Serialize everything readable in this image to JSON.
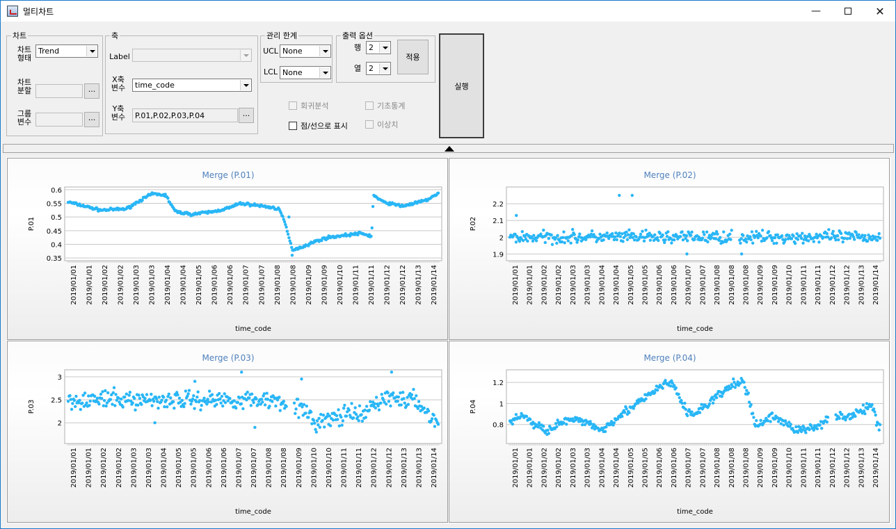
{
  "window": {
    "title": "멀티차트"
  },
  "chart_group": {
    "title": "차트",
    "type_label": "차트\n형태",
    "type_value": "Trend",
    "split_label": "차트\n분할",
    "split_value": "",
    "split_button": "...",
    "group_label": "그룹\n변수",
    "group_value": "",
    "group_button": "..."
  },
  "axis_group": {
    "title": "축",
    "label_label": "Label",
    "label_value": "",
    "x_label": "X축\n변수",
    "x_value": "time_code",
    "y_label": "Y축\n변수",
    "y_value": "P.01,P.02,P.03,P.04",
    "y_button": "..."
  },
  "limit_group": {
    "title": "관리 한계",
    "ucl_label": "UCL",
    "ucl_value": "None",
    "lcl_label": "LCL",
    "lcl_value": "None"
  },
  "output_group": {
    "title": "출력 옵션",
    "row_label": "행",
    "row_value": "2",
    "col_label": "열",
    "col_value": "2",
    "apply_button": "적용"
  },
  "options": {
    "regression": "회귀분석",
    "regression_enabled": false,
    "basic_stats": "기초통계",
    "basic_stats_enabled": false,
    "point_line": "점/선으로 표시",
    "point_line_enabled": true,
    "outlier": "이상치",
    "outlier_enabled": false
  },
  "run_button": "실행",
  "colors": {
    "series": "#29b6f6",
    "title": "#4f81bd",
    "grid": "#c8c8c8"
  },
  "chart_data": [
    {
      "type": "scatter",
      "title": "Merge (P.01)",
      "xlabel": "time_code",
      "ylabel": "P.01",
      "x": [
        "2019/01/01",
        "2019/01/01",
        "2019/01/02",
        "2019/01/02",
        "2019/01/03",
        "2019/01/03",
        "2019/01/04",
        "2019/01/04",
        "2019/01/05",
        "2019/01/06",
        "2019/01/06",
        "2019/01/07",
        "2019/01/07",
        "2019/01/08",
        "2019/01/08",
        "2019/01/09",
        "2019/01/09",
        "2019/01/10",
        "2019/01/11",
        "2019/01/11",
        "2019/01/12",
        "2019/01/12",
        "2019/01/13",
        "2019/01/14"
      ],
      "ylim": [
        0.34,
        0.61
      ],
      "yticks": [
        "0.6",
        "0.55",
        "0.5",
        "0.45",
        "0.4",
        "0.35"
      ],
      "ytick_values": [
        0.6,
        0.55,
        0.5,
        0.45,
        0.4,
        0.35
      ],
      "profile": [
        [
          0,
          0.555
        ],
        [
          0.05,
          0.54
        ],
        [
          0.1,
          0.525
        ],
        [
          0.18,
          0.53
        ],
        [
          0.22,
          0.56
        ],
        [
          0.26,
          0.585
        ],
        [
          0.3,
          0.58
        ],
        [
          0.33,
          0.52
        ],
        [
          0.38,
          0.51
        ],
        [
          0.45,
          0.52
        ],
        [
          0.5,
          0.535
        ],
        [
          0.53,
          0.55
        ],
        [
          0.6,
          0.54
        ],
        [
          0.65,
          0.53
        ],
        [
          0.67,
          0.47
        ],
        [
          0.69,
          0.38
        ],
        [
          0.72,
          0.39
        ],
        [
          0.76,
          0.41
        ],
        [
          0.8,
          0.425
        ],
        [
          0.9,
          0.44
        ],
        [
          0.935,
          0.43
        ],
        [
          0.94,
          0.58
        ],
        [
          0.97,
          0.555
        ],
        [
          1.03,
          0.54
        ],
        [
          1.1,
          0.56
        ],
        [
          1.14,
          0.585
        ]
      ],
      "gaps": [],
      "noise": 0.004,
      "outliers": [
        [
          0.68,
          0.5
        ],
        [
          0.69,
          0.36
        ]
      ]
    },
    {
      "type": "scatter",
      "title": "Merge (P.02)",
      "xlabel": "time_code",
      "ylabel": "P.02",
      "x": [
        "2019/01/01",
        "2019/01/01",
        "2019/01/02",
        "2019/01/02",
        "2019/01/03",
        "2019/01/03",
        "2019/01/04",
        "2019/01/04",
        "2019/01/05",
        "2019/01/05",
        "2019/01/06",
        "2019/01/06",
        "2019/01/07",
        "2019/01/07",
        "2019/01/08",
        "2019/01/08",
        "2019/01/08",
        "2019/01/09",
        "2019/01/09",
        "2019/01/10",
        "2019/01/11",
        "2019/01/11",
        "2019/01/12",
        "2019/01/12",
        "2019/01/13",
        "2019/01/14"
      ],
      "ylim": [
        1.86,
        2.3
      ],
      "yticks": [
        "2.2",
        "2.1",
        "2",
        "1.9"
      ],
      "ytick_values": [
        2.2,
        2.1,
        2.0,
        1.9
      ],
      "profile": [
        [
          0,
          2.0
        ],
        [
          1.15,
          2.0
        ]
      ],
      "gaps": [
        [
          0.6,
          0.62
        ]
      ],
      "noise": 0.03,
      "outliers": [
        [
          0.02,
          2.13
        ],
        [
          0.34,
          2.25
        ],
        [
          0.38,
          2.25
        ],
        [
          0.55,
          1.9
        ],
        [
          0.72,
          1.9
        ]
      ]
    },
    {
      "type": "scatter",
      "title": "Merge (P.03)",
      "xlabel": "time_code",
      "ylabel": "P.03",
      "x": [
        "2019/01/01",
        "2019/01/01",
        "2019/01/02",
        "2019/01/02",
        "2019/01/03",
        "2019/01/03",
        "2019/01/04",
        "2019/01/05",
        "2019/01/05",
        "2019/01/06",
        "2019/01/06",
        "2019/01/07",
        "2019/01/07",
        "2019/01/08",
        "2019/01/08",
        "2019/01/09",
        "2019/01/10",
        "2019/01/10",
        "2019/01/11",
        "2019/01/11",
        "2019/01/12",
        "2019/01/12",
        "2019/01/13",
        "2019/01/13",
        "2019/01/14"
      ],
      "ylim": [
        1.55,
        3.15
      ],
      "yticks": [
        "3",
        "2.5",
        "2"
      ],
      "ytick_values": [
        3,
        2.5,
        2
      ],
      "profile": [
        [
          0,
          2.5
        ],
        [
          0.63,
          2.5
        ],
        [
          0.66,
          2.45
        ],
        [
          0.7,
          2.3
        ],
        [
          0.74,
          2.0
        ],
        [
          0.77,
          2.05
        ],
        [
          0.8,
          2.1
        ],
        [
          0.85,
          2.2
        ],
        [
          0.88,
          2.1
        ],
        [
          0.9,
          2.3
        ],
        [
          0.95,
          2.55
        ],
        [
          1.02,
          2.5
        ],
        [
          1.05,
          2.45
        ],
        [
          1.09,
          2.1
        ],
        [
          1.11,
          2.0
        ]
      ],
      "gaps": [
        [
          0.59,
          0.61
        ]
      ],
      "noise": 0.16,
      "outliers": [
        [
          0.38,
          2.9
        ],
        [
          0.52,
          3.1
        ],
        [
          0.7,
          2.95
        ],
        [
          0.97,
          3.1
        ],
        [
          0.26,
          2.0
        ],
        [
          0.56,
          1.9
        ]
      ]
    },
    {
      "type": "scatter",
      "title": "Merge (P.04)",
      "xlabel": "time_code",
      "ylabel": "P.04",
      "x": [
        "2019/01/01",
        "2019/01/01",
        "2019/01/02",
        "2019/01/02",
        "2019/01/03",
        "2019/01/03",
        "2019/01/04",
        "2019/01/04",
        "2019/01/05",
        "2019/01/05",
        "2019/01/06",
        "2019/01/06",
        "2019/01/07",
        "2019/01/07",
        "2019/01/08",
        "2019/01/08",
        "2019/01/08",
        "2019/01/09",
        "2019/01/09",
        "2019/01/10",
        "2019/01/11",
        "2019/01/11",
        "2019/01/12",
        "2019/01/12",
        "2019/01/13",
        "2019/01/14"
      ],
      "ylim": [
        0.62,
        1.32
      ],
      "yticks": [
        "1.2",
        "1",
        "0.8"
      ],
      "ytick_values": [
        1.2,
        1.0,
        0.8
      ],
      "profile": [
        [
          0,
          0.82
        ],
        [
          0.05,
          0.9
        ],
        [
          0.08,
          0.8
        ],
        [
          0.13,
          0.75
        ],
        [
          0.2,
          0.84
        ],
        [
          0.28,
          0.82
        ],
        [
          0.32,
          0.74
        ],
        [
          0.38,
          0.88
        ],
        [
          0.45,
          1.0
        ],
        [
          0.5,
          1.1
        ],
        [
          0.55,
          1.2
        ],
        [
          0.58,
          1.15
        ],
        [
          0.62,
          0.92
        ],
        [
          0.65,
          0.9
        ],
        [
          0.72,
          1.05
        ],
        [
          0.78,
          1.17
        ],
        [
          0.82,
          1.22
        ],
        [
          0.86,
          0.82
        ],
        [
          0.88,
          0.8
        ],
        [
          0.92,
          0.88
        ],
        [
          0.97,
          0.82
        ],
        [
          1.0,
          0.75
        ],
        [
          1.04,
          0.75
        ],
        [
          1.08,
          0.78
        ],
        [
          1.12,
          0.88
        ],
        [
          1.2,
          0.88
        ],
        [
          1.27,
          0.98
        ],
        [
          1.3,
          0.76
        ]
      ],
      "gaps": [
        [
          0.86,
          0.88
        ]
      ],
      "noise": 0.035,
      "outliers": []
    }
  ]
}
